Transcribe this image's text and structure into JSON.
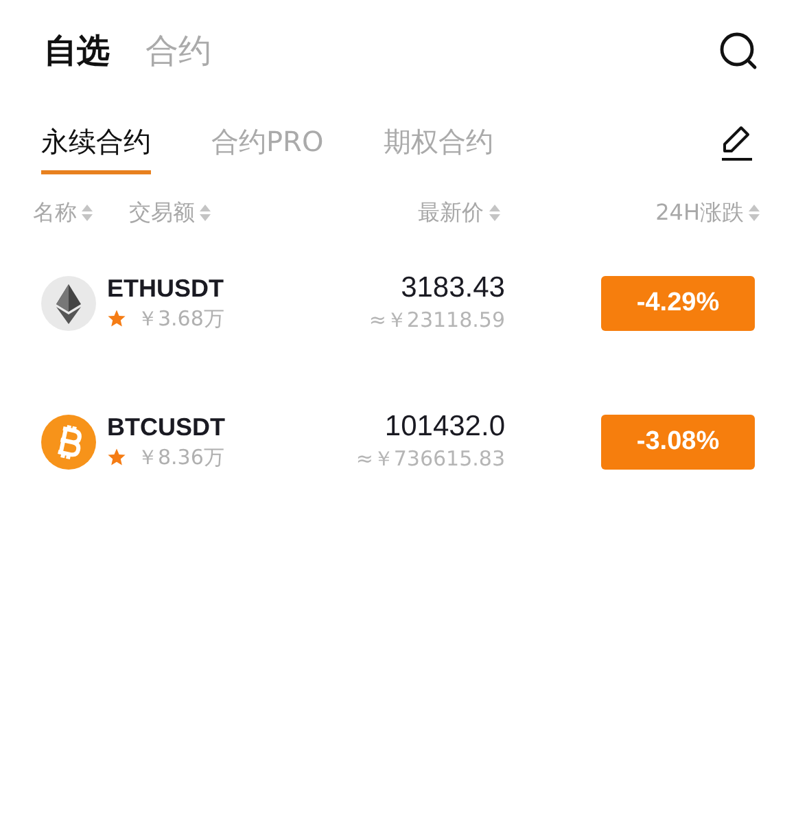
{
  "top_tabs": [
    {
      "label": "自选",
      "selected": true
    },
    {
      "label": "合约",
      "selected": false
    }
  ],
  "sub_tabs": [
    {
      "label": "永续合约",
      "selected": true
    },
    {
      "label": "合约PRO",
      "selected": false
    },
    {
      "label": "期权合约",
      "selected": false
    }
  ],
  "columns": [
    "名称",
    "交易额",
    "最新价",
    "24H涨跌"
  ],
  "rows": [
    {
      "kind": "eth",
      "symbol": "ETHUSDT",
      "favorite": true,
      "volume": "￥3.68万",
      "price": "3183.43",
      "price_cny": "≈￥23118.59",
      "change": "-4.29%"
    },
    {
      "kind": "btc",
      "symbol": "BTCUSDT",
      "favorite": true,
      "volume": "￥8.36万",
      "price": "101432.0",
      "price_cny": "≈￥736615.83",
      "change": "-3.08%"
    }
  ]
}
